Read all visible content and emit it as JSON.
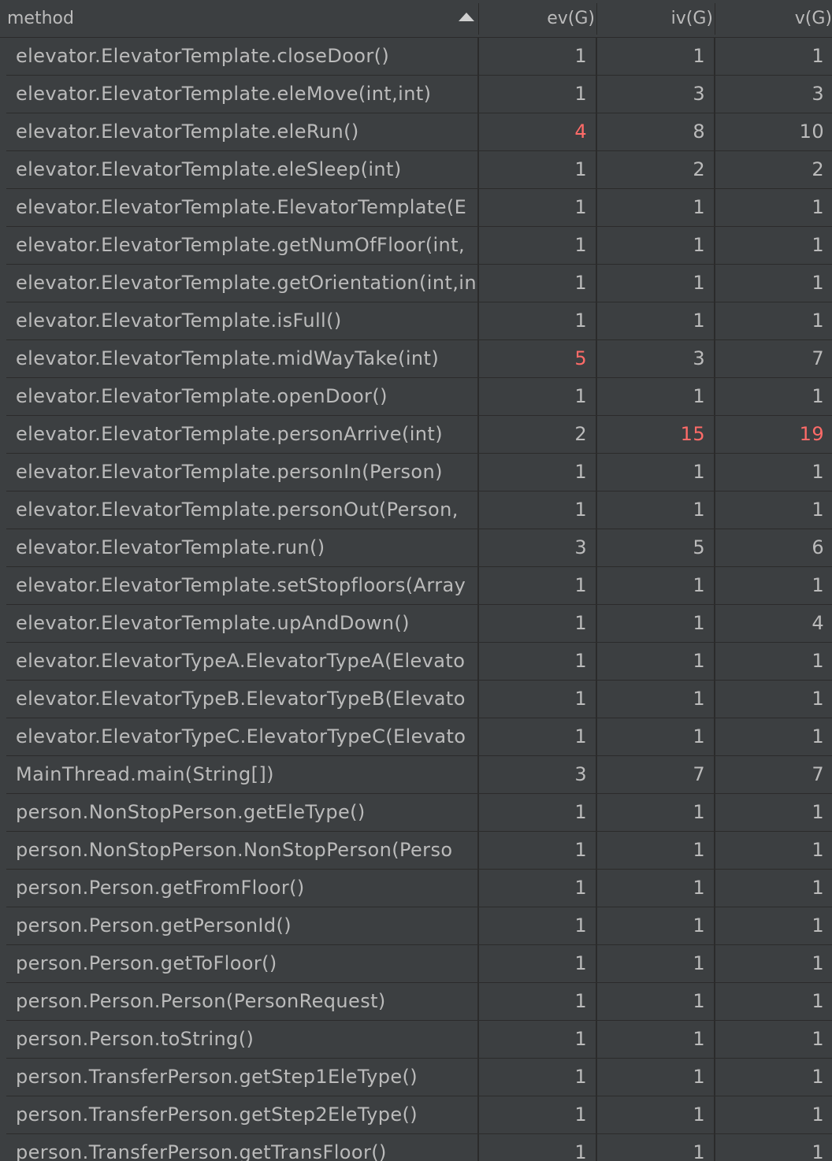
{
  "header": {
    "method": "method",
    "ev": "ev(G)",
    "iv": "iv(G)",
    "v": "v(G)"
  },
  "colors": {
    "background": "#3c3f41",
    "text": "#bbbbbb",
    "grid": "#2b2b2b",
    "highlight": "#ff6b68"
  },
  "rows": [
    {
      "method": "elevator.ElevatorTemplate.closeDoor()",
      "ev": "1",
      "iv": "1",
      "v": "1"
    },
    {
      "method": "elevator.ElevatorTemplate.eleMove(int,int)",
      "ev": "1",
      "iv": "3",
      "v": "3"
    },
    {
      "method": "elevator.ElevatorTemplate.eleRun()",
      "ev": "4",
      "iv": "8",
      "v": "10",
      "hot": [
        "ev"
      ]
    },
    {
      "method": "elevator.ElevatorTemplate.eleSleep(int)",
      "ev": "1",
      "iv": "2",
      "v": "2"
    },
    {
      "method": "elevator.ElevatorTemplate.ElevatorTemplate(E",
      "ev": "1",
      "iv": "1",
      "v": "1"
    },
    {
      "method": "elevator.ElevatorTemplate.getNumOfFloor(int,",
      "ev": "1",
      "iv": "1",
      "v": "1"
    },
    {
      "method": "elevator.ElevatorTemplate.getOrientation(int,in",
      "ev": "1",
      "iv": "1",
      "v": "1"
    },
    {
      "method": "elevator.ElevatorTemplate.isFull()",
      "ev": "1",
      "iv": "1",
      "v": "1"
    },
    {
      "method": "elevator.ElevatorTemplate.midWayTake(int)",
      "ev": "5",
      "iv": "3",
      "v": "7",
      "hot": [
        "ev"
      ]
    },
    {
      "method": "elevator.ElevatorTemplate.openDoor()",
      "ev": "1",
      "iv": "1",
      "v": "1"
    },
    {
      "method": "elevator.ElevatorTemplate.personArrive(int)",
      "ev": "2",
      "iv": "15",
      "v": "19",
      "hot": [
        "iv",
        "v"
      ]
    },
    {
      "method": "elevator.ElevatorTemplate.personIn(Person)",
      "ev": "1",
      "iv": "1",
      "v": "1"
    },
    {
      "method": "elevator.ElevatorTemplate.personOut(Person,",
      "ev": "1",
      "iv": "1",
      "v": "1"
    },
    {
      "method": "elevator.ElevatorTemplate.run()",
      "ev": "3",
      "iv": "5",
      "v": "6"
    },
    {
      "method": "elevator.ElevatorTemplate.setStopfloors(Array",
      "ev": "1",
      "iv": "1",
      "v": "1"
    },
    {
      "method": "elevator.ElevatorTemplate.upAndDown()",
      "ev": "1",
      "iv": "1",
      "v": "4"
    },
    {
      "method": "elevator.ElevatorTypeA.ElevatorTypeA(Elevato",
      "ev": "1",
      "iv": "1",
      "v": "1"
    },
    {
      "method": "elevator.ElevatorTypeB.ElevatorTypeB(Elevato",
      "ev": "1",
      "iv": "1",
      "v": "1"
    },
    {
      "method": "elevator.ElevatorTypeC.ElevatorTypeC(Elevato",
      "ev": "1",
      "iv": "1",
      "v": "1"
    },
    {
      "method": "MainThread.main(String[])",
      "ev": "3",
      "iv": "7",
      "v": "7"
    },
    {
      "method": "person.NonStopPerson.getEleType()",
      "ev": "1",
      "iv": "1",
      "v": "1"
    },
    {
      "method": "person.NonStopPerson.NonStopPerson(Perso",
      "ev": "1",
      "iv": "1",
      "v": "1"
    },
    {
      "method": "person.Person.getFromFloor()",
      "ev": "1",
      "iv": "1",
      "v": "1"
    },
    {
      "method": "person.Person.getPersonId()",
      "ev": "1",
      "iv": "1",
      "v": "1"
    },
    {
      "method": "person.Person.getToFloor()",
      "ev": "1",
      "iv": "1",
      "v": "1"
    },
    {
      "method": "person.Person.Person(PersonRequest)",
      "ev": "1",
      "iv": "1",
      "v": "1"
    },
    {
      "method": "person.Person.toString()",
      "ev": "1",
      "iv": "1",
      "v": "1"
    },
    {
      "method": "person.TransferPerson.getStep1EleType()",
      "ev": "1",
      "iv": "1",
      "v": "1"
    },
    {
      "method": "person.TransferPerson.getStep2EleType()",
      "ev": "1",
      "iv": "1",
      "v": "1"
    },
    {
      "method": "person.TransferPerson.getTransFloor()",
      "ev": "1",
      "iv": "1",
      "v": "1"
    }
  ]
}
